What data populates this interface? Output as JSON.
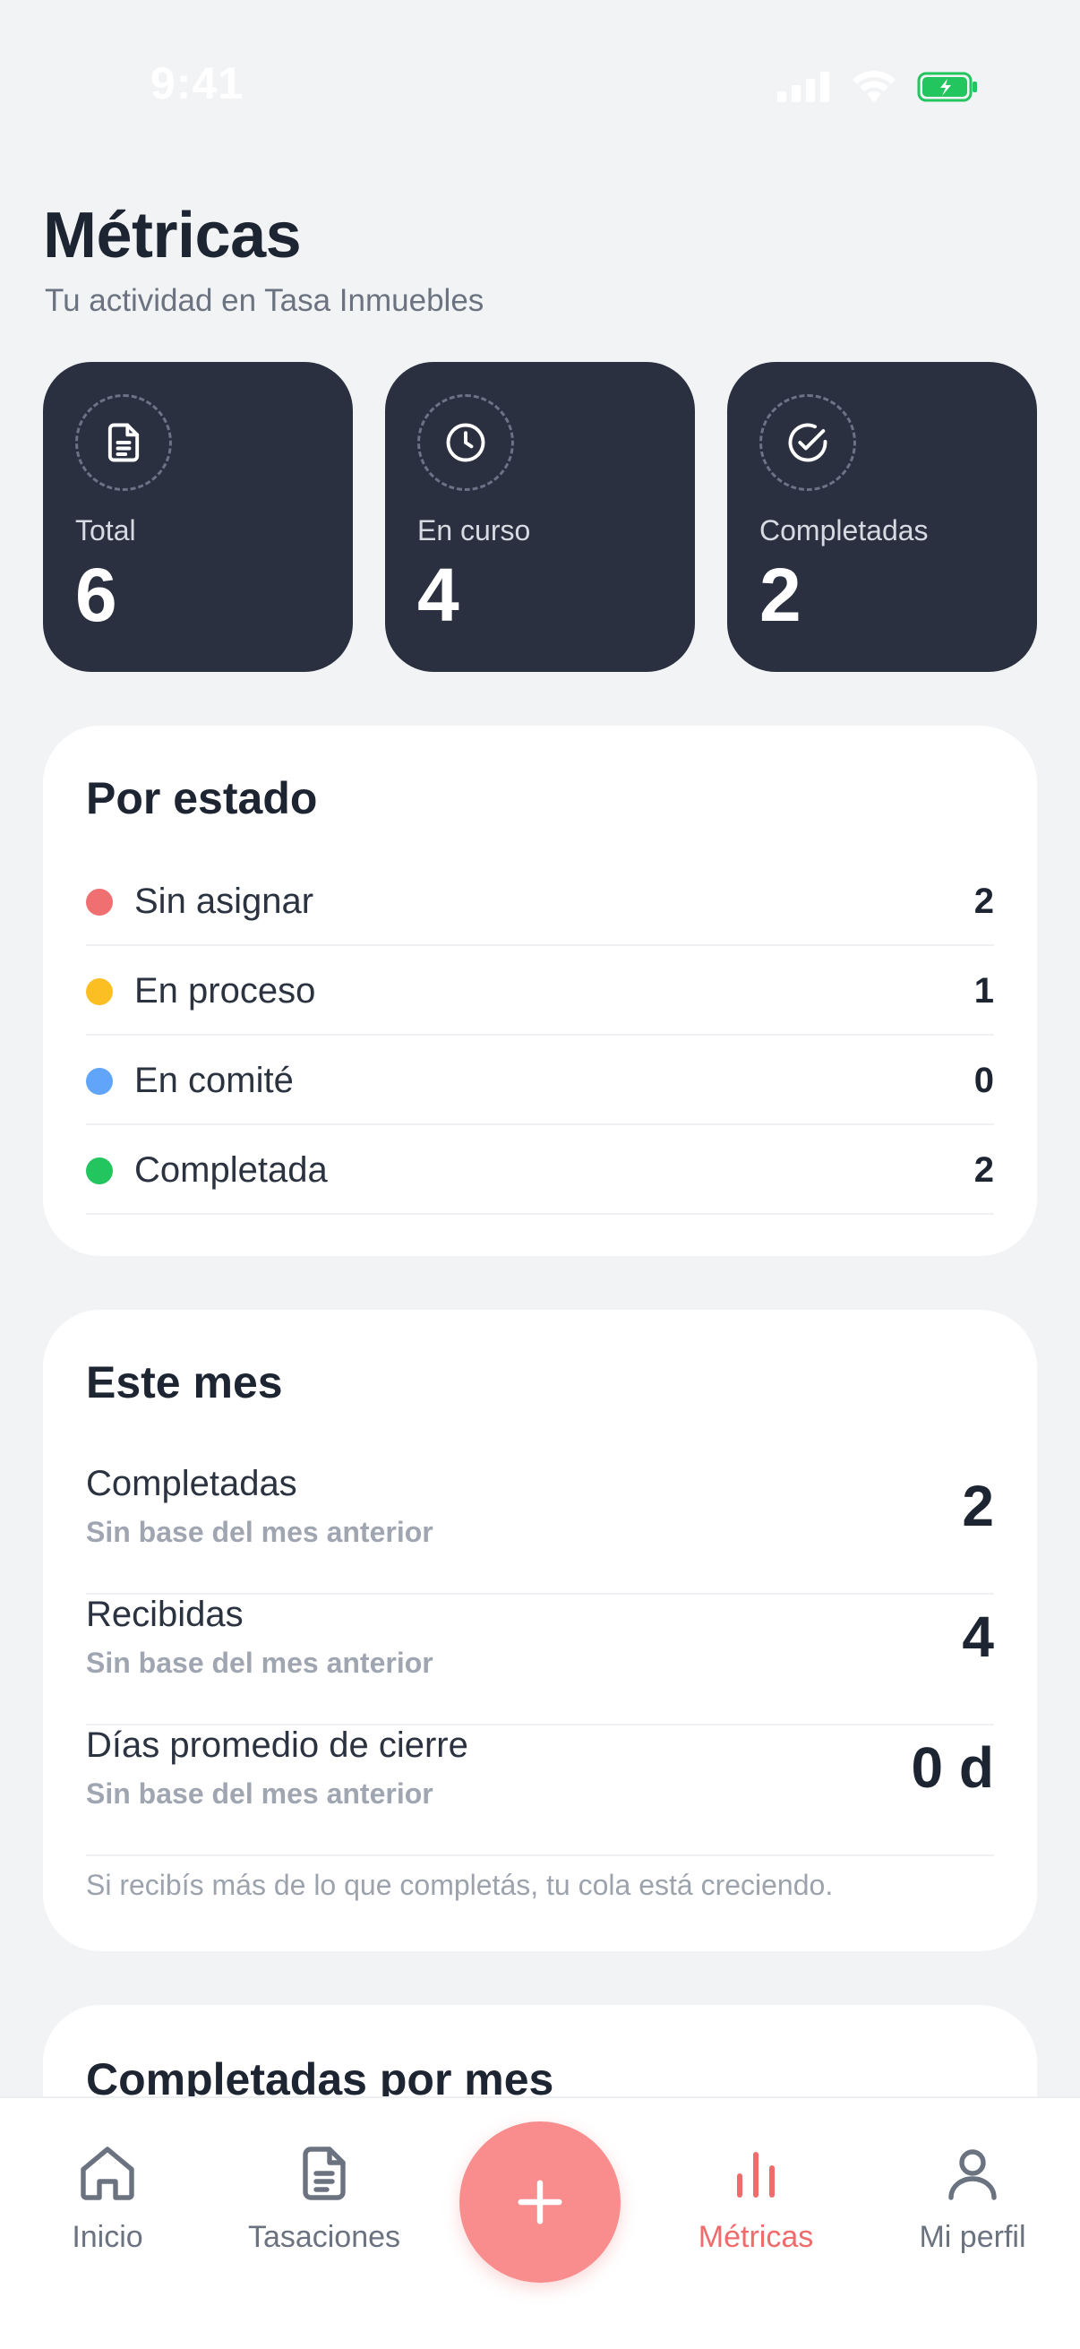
{
  "status_bar": {
    "time": "9:41"
  },
  "header": {
    "title": "Métricas",
    "subtitle": "Tu actividad en Tasa Inmuebles"
  },
  "stats": [
    {
      "label": "Total",
      "value": "6",
      "icon": "document-icon"
    },
    {
      "label": "En curso",
      "value": "4",
      "icon": "clock-icon"
    },
    {
      "label": "Completadas",
      "value": "2",
      "icon": "check-circle-icon"
    }
  ],
  "por_estado": {
    "title": "Por estado",
    "rows": [
      {
        "label": "Sin asignar",
        "count": "2",
        "color": "#f07072"
      },
      {
        "label": "En proceso",
        "count": "1",
        "color": "#fbbf24"
      },
      {
        "label": "En comité",
        "count": "0",
        "color": "#60a5fa"
      },
      {
        "label": "Completada",
        "count": "2",
        "color": "#22c55e"
      }
    ]
  },
  "este_mes": {
    "title": "Este mes",
    "rows": [
      {
        "label": "Completadas",
        "sub": "Sin base del mes anterior",
        "value": "2"
      },
      {
        "label": "Recibidas",
        "sub": "Sin base del mes anterior",
        "value": "4"
      },
      {
        "label": "Días promedio de cierre",
        "sub": "Sin base del mes anterior",
        "value": "0 d"
      }
    ],
    "note": "Si recibís más de lo que completás, tu cola está creciendo."
  },
  "completadas_por_mes": {
    "title": "Completadas por mes"
  },
  "nav": {
    "items": [
      {
        "label": "Inicio",
        "icon": "home-icon"
      },
      {
        "label": "Tasaciones",
        "icon": "document-icon"
      },
      {
        "label": "Métricas",
        "icon": "bar-chart-icon"
      },
      {
        "label": "Mi perfil",
        "icon": "user-icon"
      }
    ],
    "active": "Métricas",
    "fab_icon": "plus-icon"
  },
  "colors": {
    "background": "#f2f3f5",
    "card_dark": "#2a303f",
    "accent": "#f06b6b",
    "fab": "#f98c8c"
  }
}
